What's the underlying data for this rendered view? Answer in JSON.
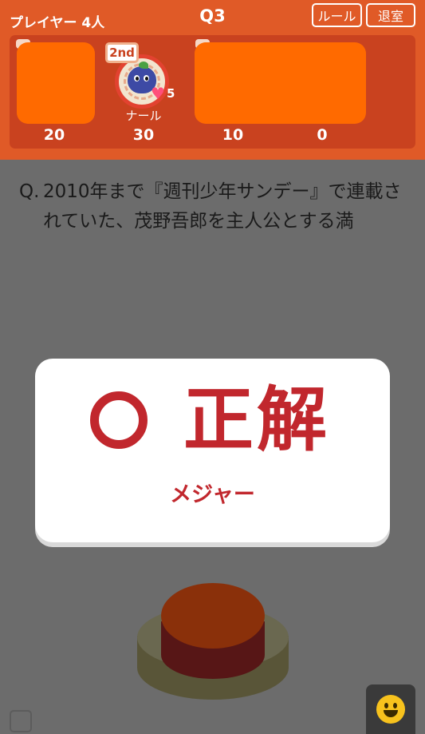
{
  "header": {
    "players_label": "プレイヤー 4人",
    "question_number": "Q3",
    "rule_button": "ルール",
    "exit_button": "退室"
  },
  "players": [
    {
      "score": "20"
    },
    {
      "name": "ナール",
      "rank": "2nd",
      "hearts": "5",
      "score": "30"
    },
    {
      "score": "10"
    },
    {
      "score": "0"
    }
  ],
  "question": {
    "prefix": "Q.",
    "text": "2010年まで『週刊少年サンデー』で連載されていた、茂野吾郎を主人公とする満"
  },
  "result": {
    "title": "正解",
    "answer": "メジャー",
    "color": "#c1272d"
  },
  "colors": {
    "header_bg": "#e05a27",
    "panel_bg": "#c9421f",
    "overlay_bg": "#6c6c6c"
  },
  "icons": {
    "correct": "circle-icon",
    "emoji": "smiley-icon",
    "connection": "wifi-icon",
    "heart": "heart-icon"
  }
}
